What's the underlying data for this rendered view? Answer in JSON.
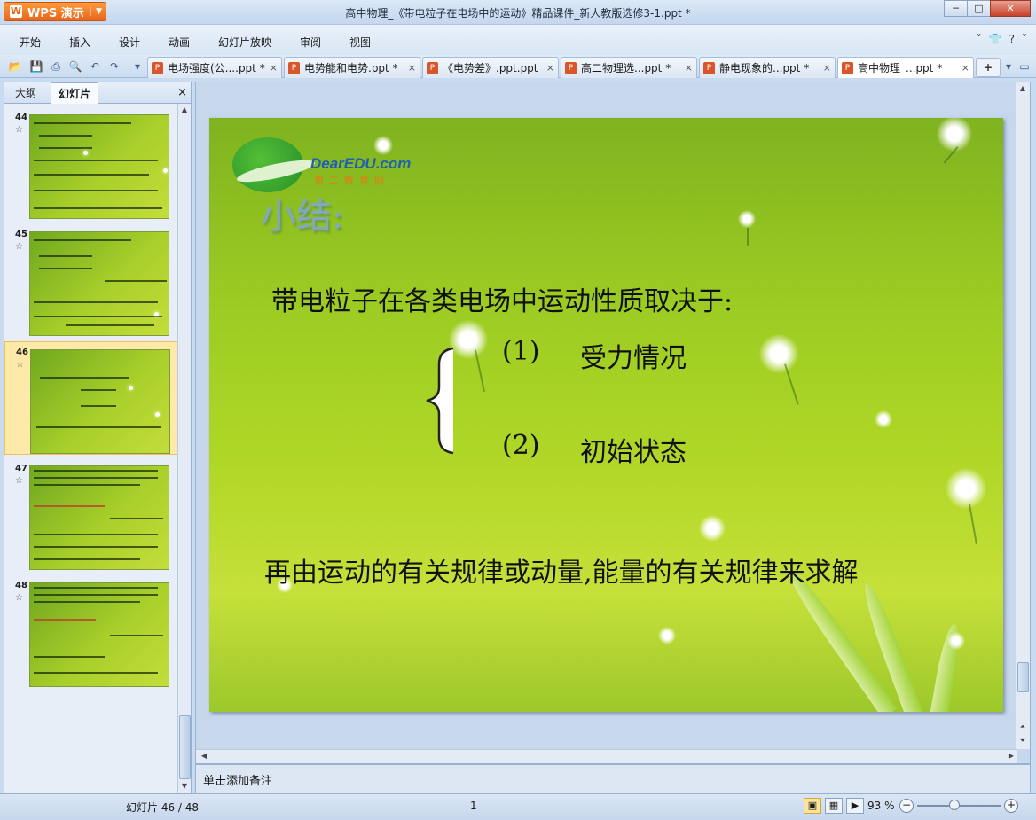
{
  "app": {
    "logo_label": "WPS 演示",
    "logo_glyph": "W",
    "window_title": "高中物理_《带电粒子在电场中的运动》精品课件_新人教版选修3-1.ppt *"
  },
  "window_controls": {
    "minimize": "─",
    "maximize": "□",
    "close": "✕"
  },
  "menu": {
    "items": [
      "开始",
      "插入",
      "设计",
      "动画",
      "幻灯片放映",
      "审阅",
      "视图"
    ],
    "right_icons": [
      "˅",
      "👕",
      "?",
      "˅"
    ]
  },
  "toolbar": {
    "icons": [
      "open-icon",
      "save-icon",
      "print-icon",
      "print-preview-icon",
      "undo-icon",
      "redo-icon",
      "customize-icon"
    ]
  },
  "doc_tabs": [
    {
      "label": "电场强度(公....ppt *",
      "close": "×"
    },
    {
      "label": "电势能和电势.ppt *",
      "close": "×"
    },
    {
      "label": "《电势差》.ppt.ppt",
      "close": "×"
    },
    {
      "label": "高二物理选...ppt *",
      "close": "×"
    },
    {
      "label": "静电现象的...ppt *",
      "close": "×"
    },
    {
      "label": "高中物理_...ppt *",
      "close": "×"
    }
  ],
  "tab_add": "+",
  "left_panel": {
    "tabs": [
      "大纲",
      "幻灯片"
    ],
    "close": "×",
    "thumbnails": [
      {
        "number": "44",
        "star": "☆"
      },
      {
        "number": "45",
        "star": "☆"
      },
      {
        "number": "46",
        "star": "☆"
      },
      {
        "number": "47",
        "star": "☆"
      },
      {
        "number": "48",
        "star": "☆"
      }
    ],
    "selected_index": 2
  },
  "slide": {
    "logo": {
      "text": "DearEDU.com",
      "sub": "第二教育网"
    },
    "heading": "小结:",
    "line1": "带电粒子在各类电场中运动性质取决于:",
    "item1_num": "(1)",
    "item1_text": "受力情况",
    "item2_num": "(2)",
    "item2_text": "初始状态",
    "line2": "再由运动的有关规律或动量,能量的有关规律来求解"
  },
  "notes": {
    "placeholder": "单击添加备注"
  },
  "status": {
    "slide_counter": "幻灯片 46 / 48",
    "center": "1",
    "zoom": "93 %",
    "zoom_fraction": 0.45
  }
}
